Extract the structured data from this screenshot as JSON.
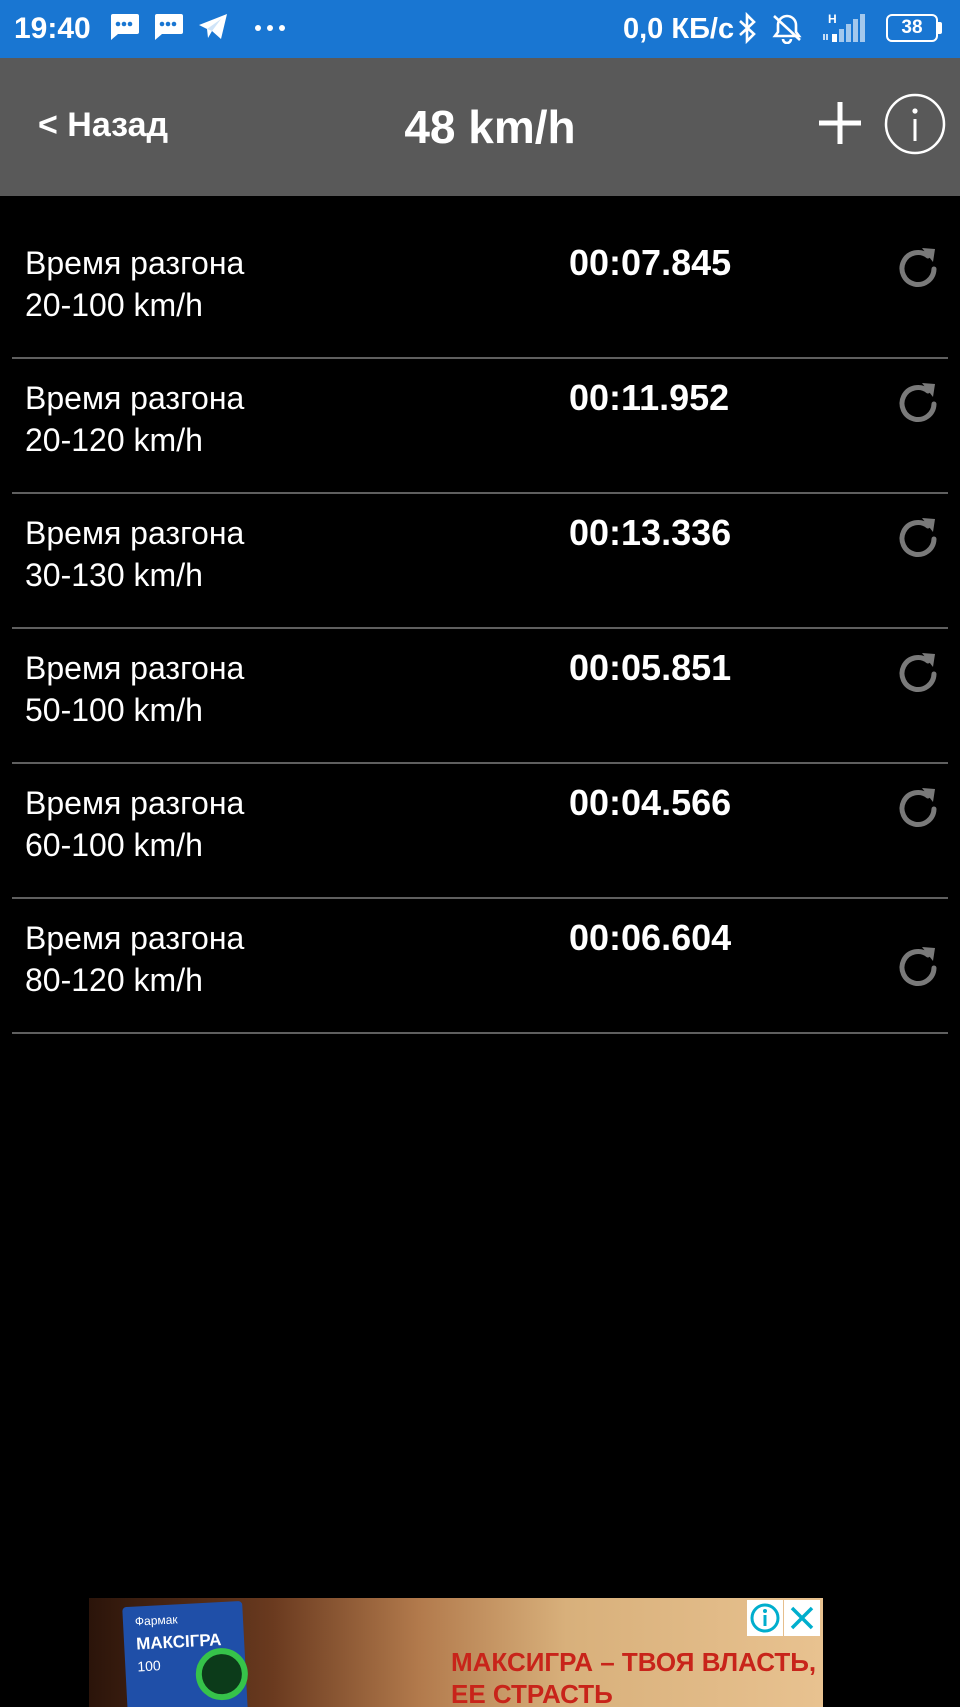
{
  "status_bar": {
    "time": "19:40",
    "network_speed": "0,0 КБ/с",
    "battery": "38",
    "icons": [
      "message-icon",
      "message-icon",
      "telegram-icon",
      "more-dots-icon",
      "bluetooth-icon",
      "alarm-off-icon",
      "signal-icon"
    ]
  },
  "appbar": {
    "back_label": "< Назад",
    "title": "48 km/h",
    "add_icon": "plus-icon",
    "info_icon": "info-icon"
  },
  "results": [
    {
      "label_line1": "Время разгона",
      "label_line2": "20-100 km/h",
      "time": "00:07.845"
    },
    {
      "label_line1": "Время разгона",
      "label_line2": "20-120 km/h",
      "time": "00:11.952"
    },
    {
      "label_line1": "Время разгона",
      "label_line2": "30-130 km/h",
      "time": "00:13.336"
    },
    {
      "label_line1": "Время разгона",
      "label_line2": "50-100 km/h",
      "time": "00:05.851"
    },
    {
      "label_line1": "Время разгона",
      "label_line2": "60-100 km/h",
      "time": "00:04.566"
    },
    {
      "label_line1": "Время разгона",
      "label_line2": "80-120 km/h",
      "time": "00:06.604"
    }
  ],
  "ad": {
    "product_brand": "Фармак",
    "product_name": "МАКСIГРА",
    "product_dose": "100",
    "headline_line1": "МАКСИГРА – ТВОЯ ВЛАСТЬ,",
    "headline_line2": "ЕЕ СТРАСТЬ"
  },
  "colors": {
    "status_bar": "#1976d2",
    "app_bar": "#595959",
    "background": "#000000",
    "divider": "#5f5f5f",
    "refresh_icon": "#7a7a7a"
  }
}
